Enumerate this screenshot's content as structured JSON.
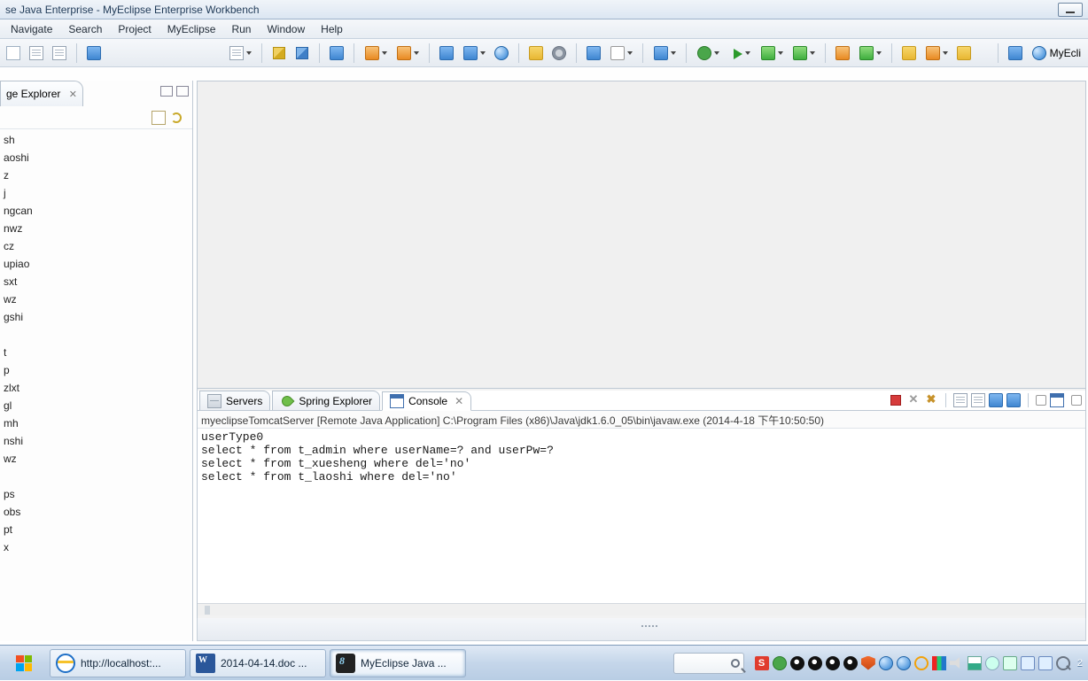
{
  "window": {
    "title": "se Java Enterprise - MyEclipse Enterprise Workbench"
  },
  "menu": [
    "Navigate",
    "Search",
    "Project",
    "MyEclipse",
    "Run",
    "Window",
    "Help"
  ],
  "perspective_label": "MyEcli",
  "package_explorer": {
    "tab_label": "ge Explorer",
    "items": [
      "sh",
      "aoshi",
      "z",
      "j",
      "ngcan",
      "nwz",
      "cz",
      "upiao",
      "sxt",
      "wz",
      "gshi",
      "",
      "t",
      "p",
      "zlxt",
      "gl",
      "mh",
      "nshi",
      "wz",
      "",
      "ps",
      "obs",
      "pt",
      "x"
    ]
  },
  "bottom_tabs": {
    "servers": "Servers",
    "spring": "Spring Explorer",
    "console": "Console"
  },
  "console": {
    "title": "myeclipseTomcatServer [Remote Java Application] C:\\Program Files (x86)\\Java\\jdk1.6.0_05\\bin\\javaw.exe (2014-4-18 下午10:50:50)",
    "lines": [
      "userType0",
      "select * from t_admin where userName=? and userPw=?",
      "select * from t_xuesheng where del='no'",
      "select * from t_laoshi where del='no'"
    ]
  },
  "taskbar": {
    "items": [
      {
        "label": "http://localhost:..."
      },
      {
        "label": "2014-04-14.doc ..."
      },
      {
        "label": "MyEclipse Java ..."
      }
    ],
    "clock": "2"
  }
}
